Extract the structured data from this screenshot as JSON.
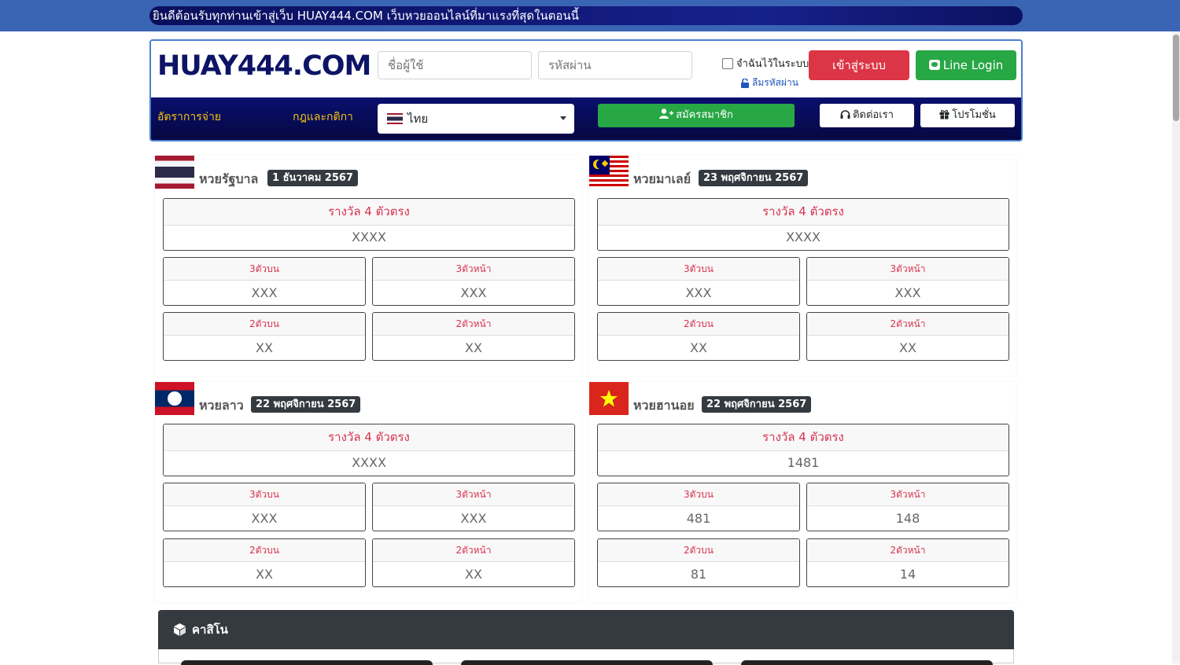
{
  "marquee": "ยินดีต้อนรับทุกท่านเข้าสู่เว็บ HUAY444.COM เว็บหวยออนไลน์ที่มาแรงที่สุดในตอนนี้",
  "header": {
    "logo": "HUAY444.COM",
    "username_placeholder": "ชื่อผู้ใช้",
    "password_placeholder": "รหัสผ่าน",
    "remember_label": "จำฉันไว้ในระบบ",
    "forgot_label": "ลืมรหัสผ่าน",
    "login_label": "เข้าสู่ระบบ",
    "line_login_label": "Line Login"
  },
  "nav": {
    "rates": "อัตราการจ่าย",
    "rules": "กฎและกติกา",
    "language": "ไทย",
    "register": "สมัครสมาชิก",
    "contact": "ติดต่อเรา",
    "promotion": "โปรโมชั่น"
  },
  "lotteries": [
    {
      "name": "หวยรัฐบาล",
      "date": "1 ธันวาคม 2567",
      "flag_icon": "thailand-flag-icon",
      "first_label": "รางวัล 4 ตัวตรง",
      "first_value": "XXXX",
      "top3_label": "3ตัวบน",
      "top3_value": "XXX",
      "front3_label": "3ตัวหน้า",
      "front3_value": "XXX",
      "top2_label": "2ตัวบน",
      "top2_value": "XX",
      "front2_label": "2ตัวหน้า",
      "front2_value": "XX"
    },
    {
      "name": "หวยมาเลย์",
      "date": "23 พฤศจิกายน 2567",
      "flag_icon": "malaysia-flag-icon",
      "first_label": "รางวัล 4 ตัวตรง",
      "first_value": "XXXX",
      "top3_label": "3ตัวบน",
      "top3_value": "XXX",
      "front3_label": "3ตัวหน้า",
      "front3_value": "XXX",
      "top2_label": "2ตัวบน",
      "top2_value": "XX",
      "front2_label": "2ตัวหน้า",
      "front2_value": "XX"
    },
    {
      "name": "หวยลาว",
      "date": "22 พฤศจิกายน 2567",
      "flag_icon": "laos-flag-icon",
      "first_label": "รางวัล 4 ตัวตรง",
      "first_value": "XXXX",
      "top3_label": "3ตัวบน",
      "top3_value": "XXX",
      "front3_label": "3ตัวหน้า",
      "front3_value": "XXX",
      "top2_label": "2ตัวบน",
      "top2_value": "XX",
      "front2_label": "2ตัวหน้า",
      "front2_value": "XX"
    },
    {
      "name": "หวยฮานอย",
      "date": "22 พฤศจิกายน 2567",
      "flag_icon": "vietnam-flag-icon",
      "first_label": "รางวัล 4 ตัวตรง",
      "first_value": "1481",
      "top3_label": "3ตัวบน",
      "top3_value": "481",
      "front3_label": "3ตัวหน้า",
      "front3_value": "148",
      "top2_label": "2ตัวบน",
      "top2_value": "81",
      "front2_label": "2ตัวหน้า",
      "front2_value": "14"
    }
  ],
  "casino": {
    "title": "คาสิโน",
    "icon": "cube-icon"
  },
  "colors": {
    "topbar": "#3a64b4",
    "navy": "#0d1466",
    "login_red": "#dc3545",
    "green": "#28a745",
    "prize_red": "#d9324f",
    "badge_dark": "#343a40",
    "nav_gold": "#f5c518"
  }
}
